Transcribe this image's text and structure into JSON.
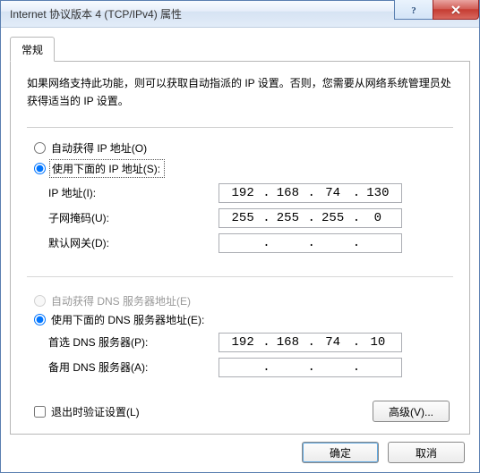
{
  "window": {
    "title": "Internet 协议版本 4 (TCP/IPv4) 属性"
  },
  "tabs": {
    "general": "常规"
  },
  "description": "如果网络支持此功能，则可以获取自动指派的 IP 设置。否则，您需要从网络系统管理员处获得适当的 IP 设置。",
  "ip_section": {
    "auto_label": "自动获得 IP 地址(O)",
    "manual_label": "使用下面的 IP 地址(S):",
    "selected": "manual",
    "fields": {
      "ip": {
        "label": "IP 地址(I):",
        "value": [
          "192",
          "168",
          "74",
          "130"
        ]
      },
      "subnet": {
        "label": "子网掩码(U):",
        "value": [
          "255",
          "255",
          "255",
          "0"
        ]
      },
      "gateway": {
        "label": "默认网关(D):",
        "value": [
          "",
          "",
          "",
          ""
        ]
      }
    }
  },
  "dns_section": {
    "auto_label": "自动获得 DNS 服务器地址(E)",
    "manual_label": "使用下面的 DNS 服务器地址(E):",
    "selected": "manual",
    "auto_disabled": true,
    "fields": {
      "preferred": {
        "label": "首选 DNS 服务器(P):",
        "value": [
          "192",
          "168",
          "74",
          "10"
        ]
      },
      "alternate": {
        "label": "备用 DNS 服务器(A):",
        "value": [
          "",
          "",
          "",
          ""
        ]
      }
    }
  },
  "validate_on_exit": {
    "label": "退出时验证设置(L)",
    "checked": false
  },
  "buttons": {
    "advanced": "高级(V)...",
    "ok": "确定",
    "cancel": "取消"
  },
  "icons": {
    "help": "?",
    "close": "×"
  }
}
